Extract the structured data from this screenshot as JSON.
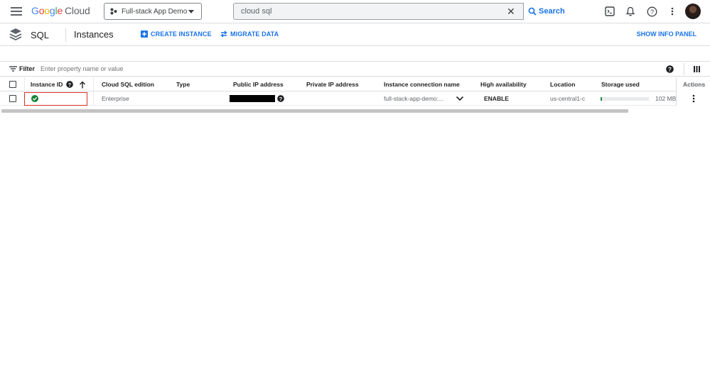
{
  "topbar": {
    "logo_google": "Google",
    "logo_cloud": "Cloud",
    "project_name": "Full-stack App Demo",
    "search_value": "cloud sql",
    "search_button": "Search"
  },
  "subbar": {
    "product": "SQL",
    "page_title": "Instances",
    "create_instance": "CREATE INSTANCE",
    "migrate_data": "MIGRATE DATA",
    "show_info_panel": "SHOW INFO PANEL"
  },
  "filter": {
    "label": "Filter",
    "placeholder": "Enter property name or value"
  },
  "table": {
    "headers": {
      "instance_id": "Instance ID",
      "edition": "Cloud SQL edition",
      "type": "Type",
      "public_ip": "Public IP address",
      "private_ip": "Private IP address",
      "connection_name": "Instance connection name",
      "high_availability": "High availability",
      "location": "Location",
      "storage_used": "Storage used",
      "actions": "Actions"
    },
    "rows": [
      {
        "instance_id": "",
        "edition": "Enterprise",
        "type": "",
        "private_ip": "",
        "connection_name": "full-stack-app-demo:...",
        "high_availability": "ENABLE",
        "location": "us-central1-c",
        "storage_used": "102 MB",
        "storage_fraction": 0.03
      }
    ]
  },
  "colors": {
    "accent": "#1a73e8",
    "status_ok": "#188038",
    "highlight": "#d93025"
  }
}
